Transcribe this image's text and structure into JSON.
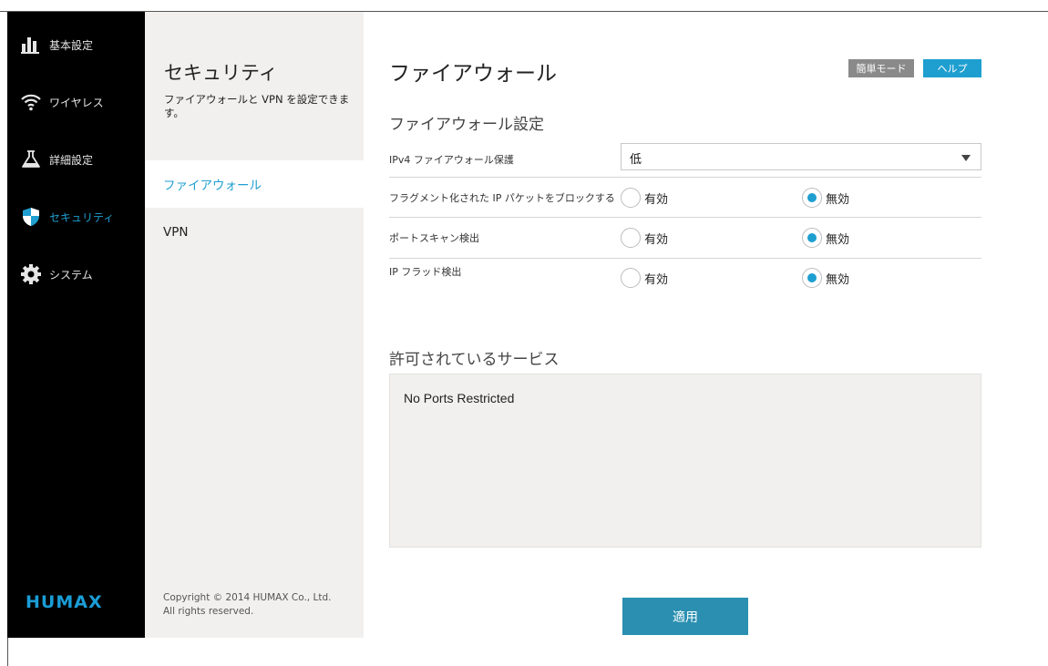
{
  "nav": {
    "items": [
      {
        "label": "基本設定",
        "icon": "bar-chart-icon"
      },
      {
        "label": "ワイヤレス",
        "icon": "wifi-icon"
      },
      {
        "label": "詳細設定",
        "icon": "flask-icon"
      },
      {
        "label": "セキュリティ",
        "icon": "shield-icon",
        "active": true
      },
      {
        "label": "システム",
        "icon": "gear-icon"
      }
    ],
    "logo": "HUMAX"
  },
  "subpanel": {
    "title": "セキュリティ",
    "description": "ファイアウォールと VPN を設定できます。",
    "items": [
      {
        "label": "ファイアウォール",
        "active": true
      },
      {
        "label": "VPN"
      }
    ],
    "copyright_line1": "Copyright © 2014 HUMAX Co., Ltd.",
    "copyright_line2": "All rights reserved."
  },
  "main": {
    "title": "ファイアウォール",
    "simple_mode_label": "簡単モード",
    "help_label": "ヘルプ",
    "firewall_section_title": "ファイアウォール設定",
    "ipv4_label": "IPv4 ファイアウォール保護",
    "ipv4_value": "低",
    "rows": [
      {
        "label": "フラグメント化された IP パケットをブロックする",
        "enable_label": "有効",
        "disable_label": "無効",
        "selected": "disable"
      },
      {
        "label": "ポートスキャン検出",
        "enable_label": "有効",
        "disable_label": "無効",
        "selected": "disable"
      },
      {
        "label": "IP フラッド検出",
        "enable_label": "有効",
        "disable_label": "無効",
        "selected": "disable"
      }
    ],
    "services_title": "許可されているサービス",
    "services_text": "No Ports Restricted",
    "apply_label": "適用"
  },
  "colors": {
    "accent": "#1e9fd0",
    "nav_bg": "#000000",
    "panel_bg": "#f1f0ee",
    "apply_bg": "#2a8fb1",
    "simple_mode_bg": "#8a8a8a"
  }
}
